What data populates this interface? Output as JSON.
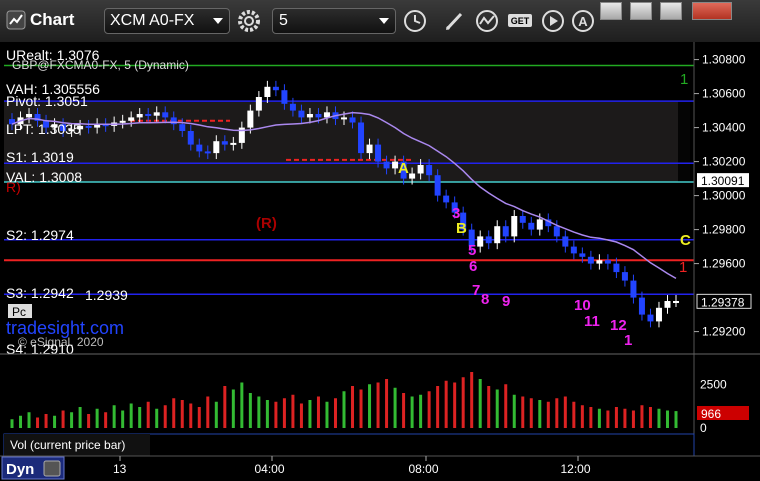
{
  "window": {
    "title": "Chart",
    "symbol": "XCM A0-FX",
    "interval": "5"
  },
  "chart_header": {
    "symbol_line": "GBP@FXCMA0-FX, 5 (Dynamic)"
  },
  "levels": [
    {
      "label": "URealt: 1.3076",
      "value": 1.3076,
      "color": "#cccccc"
    },
    {
      "label": "VAH: 1.305556",
      "value": 1.30556,
      "color": "#cccccc"
    },
    {
      "label": "Pivot: 1.3051",
      "value": 1.3051,
      "color": "#cccccc"
    },
    {
      "label": "LPT: 1.3035",
      "value": 1.3035,
      "color": "#cccccc"
    },
    {
      "label": "S1: 1.3019",
      "value": 1.3019,
      "color": "#ffffff"
    },
    {
      "label": "VAL: 1.3008",
      "value": 1.3008,
      "color": "#ffffff"
    },
    {
      "label": "S2: 1.2974",
      "value": 1.2974,
      "color": "#ffffff"
    },
    {
      "label": "S3: 1.2942",
      "value": 1.2942,
      "color": "#ffffff"
    },
    {
      "label": "1.2939",
      "value": 1.2939,
      "color": "#cccccc"
    },
    {
      "label": "S4: 1.2910",
      "value": 1.291,
      "color": "#cccccc"
    }
  ],
  "overlay_text": {
    "left_r": "R)",
    "mid_r": "(R)",
    "brand": "tradesight.com",
    "copyright": "© eSignal, 2020",
    "pc": "Pc"
  },
  "price_axis": {
    "ticks": [
      "1.30800",
      "1.30600",
      "1.30400",
      "1.30200",
      "1.30000",
      "1.29800",
      "1.29600",
      "1.29378",
      "1.29200"
    ],
    "current_price": "1.30091",
    "last_price": "1.29378"
  },
  "volume_axis": {
    "ticks": [
      "2500",
      "0"
    ],
    "current_volume": "966",
    "label": "Vol (current price bar)"
  },
  "time_axis": {
    "labels": [
      "13",
      "04:00",
      "08:00",
      "12:00"
    ]
  },
  "footer": {
    "mode": "Dyn"
  },
  "colors": {
    "up_bar": "#ffffff",
    "down_bar": "#2244ff",
    "green_level": "#22aa22",
    "red_level": "#ee2222",
    "blue_level": "#2222ee",
    "cyan_level": "#44cccc",
    "ma": "#aa88ee",
    "magenta_count": "#ee22ee",
    "yellow": "#eeee22"
  },
  "chart_data": {
    "type": "candlestick",
    "y_range": [
      1.2908,
      1.3088
    ],
    "horizontal_lines": [
      {
        "value": 1.30765,
        "color": "green",
        "label": "1"
      },
      {
        "value": 1.30556,
        "color": "blue"
      },
      {
        "value": 1.3019,
        "color": "blue"
      },
      {
        "value": 1.3008,
        "color": "cyan"
      },
      {
        "value": 1.2974,
        "color": "blue"
      },
      {
        "value": 1.2962,
        "color": "red",
        "label": "1"
      },
      {
        "value": 1.2942,
        "color": "blue"
      }
    ],
    "markers": [
      {
        "text": "A",
        "color": "yellow"
      },
      {
        "text": "B",
        "color": "yellow"
      },
      {
        "text": "C",
        "color": "yellow"
      },
      {
        "text": "1",
        "color": "green"
      },
      {
        "text": "1",
        "color": "red"
      }
    ],
    "counts": [
      "3",
      "5",
      "6",
      "7",
      "8",
      "9",
      "10",
      "11",
      "12",
      "1"
    ],
    "closes": [
      1.3042,
      1.3046,
      1.3048,
      1.3044,
      1.304,
      1.3042,
      1.3038,
      1.3039,
      1.3041,
      1.304,
      1.3042,
      1.3041,
      1.3043,
      1.3044,
      1.3046,
      1.3048,
      1.3047,
      1.3049,
      1.3046,
      1.3042,
      1.3038,
      1.303,
      1.3026,
      1.3025,
      1.3032,
      1.303,
      1.3031,
      1.304,
      1.305,
      1.3058,
      1.3064,
      1.3062,
      1.3054,
      1.305,
      1.3046,
      1.3048,
      1.3046,
      1.3049,
      1.3045,
      1.3046,
      1.3043,
      1.3025,
      1.303,
      1.302,
      1.3016,
      1.302,
      1.301,
      1.3013,
      1.3018,
      1.3012,
      1.3,
      1.2996,
      1.299,
      1.298,
      1.297,
      1.2976,
      1.2972,
      1.2982,
      1.2976,
      1.2988,
      1.2984,
      1.298,
      1.2986,
      1.2982,
      1.2976,
      1.297,
      1.2966,
      1.2964,
      1.296,
      1.2962,
      1.296,
      1.2955,
      1.295,
      1.294,
      1.293,
      1.2926,
      1.2934,
      1.2938,
      1.2938
    ],
    "volume": [
      500,
      700,
      900,
      600,
      800,
      700,
      1000,
      900,
      1200,
      800,
      1100,
      900,
      1300,
      1000,
      1400,
      1200,
      1500,
      1100,
      1300,
      1700,
      1600,
      1400,
      1200,
      1800,
      1500,
      2400,
      2200,
      2600,
      2000,
      1800,
      1600,
      1500,
      1700,
      1900,
      1400,
      1600,
      1800,
      1500,
      1700,
      2100,
      2400,
      2200,
      2500,
      2600,
      2800,
      2300,
      2000,
      1800,
      1900,
      2100,
      2400,
      2700,
      2600,
      2900,
      3200,
      2800,
      2400,
      2200,
      2500,
      1900,
      1800,
      1700,
      1600,
      1500,
      1700,
      1800,
      1500,
      1300,
      1200,
      1100,
      1000,
      1200,
      1100,
      1000,
      1300,
      1200,
      1100,
      1000,
      966
    ]
  }
}
